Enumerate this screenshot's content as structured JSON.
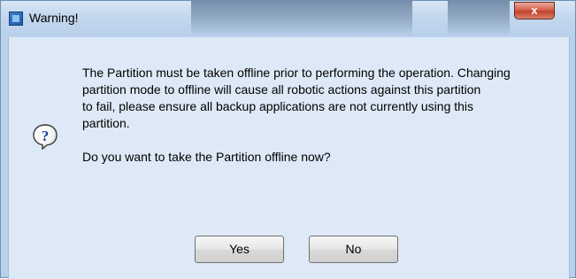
{
  "window": {
    "title": "Warning!",
    "close_glyph": "x",
    "icon": "app-window-icon"
  },
  "dialog": {
    "icon": "question-mark-icon",
    "message": "The Partition must be taken offline prior to performing the operation. Changing\npartition mode to offline will cause all robotic actions against this partition\nto fail, please ensure all backup applications are not currently using this\npartition.",
    "question": "Do you want to take the Partition offline now?"
  },
  "buttons": {
    "yes_label": "Yes",
    "no_label": "No"
  },
  "colors": {
    "client_background": "#dde9f6",
    "titlebar": "#c4d8ee",
    "close_button": "#c24228"
  }
}
